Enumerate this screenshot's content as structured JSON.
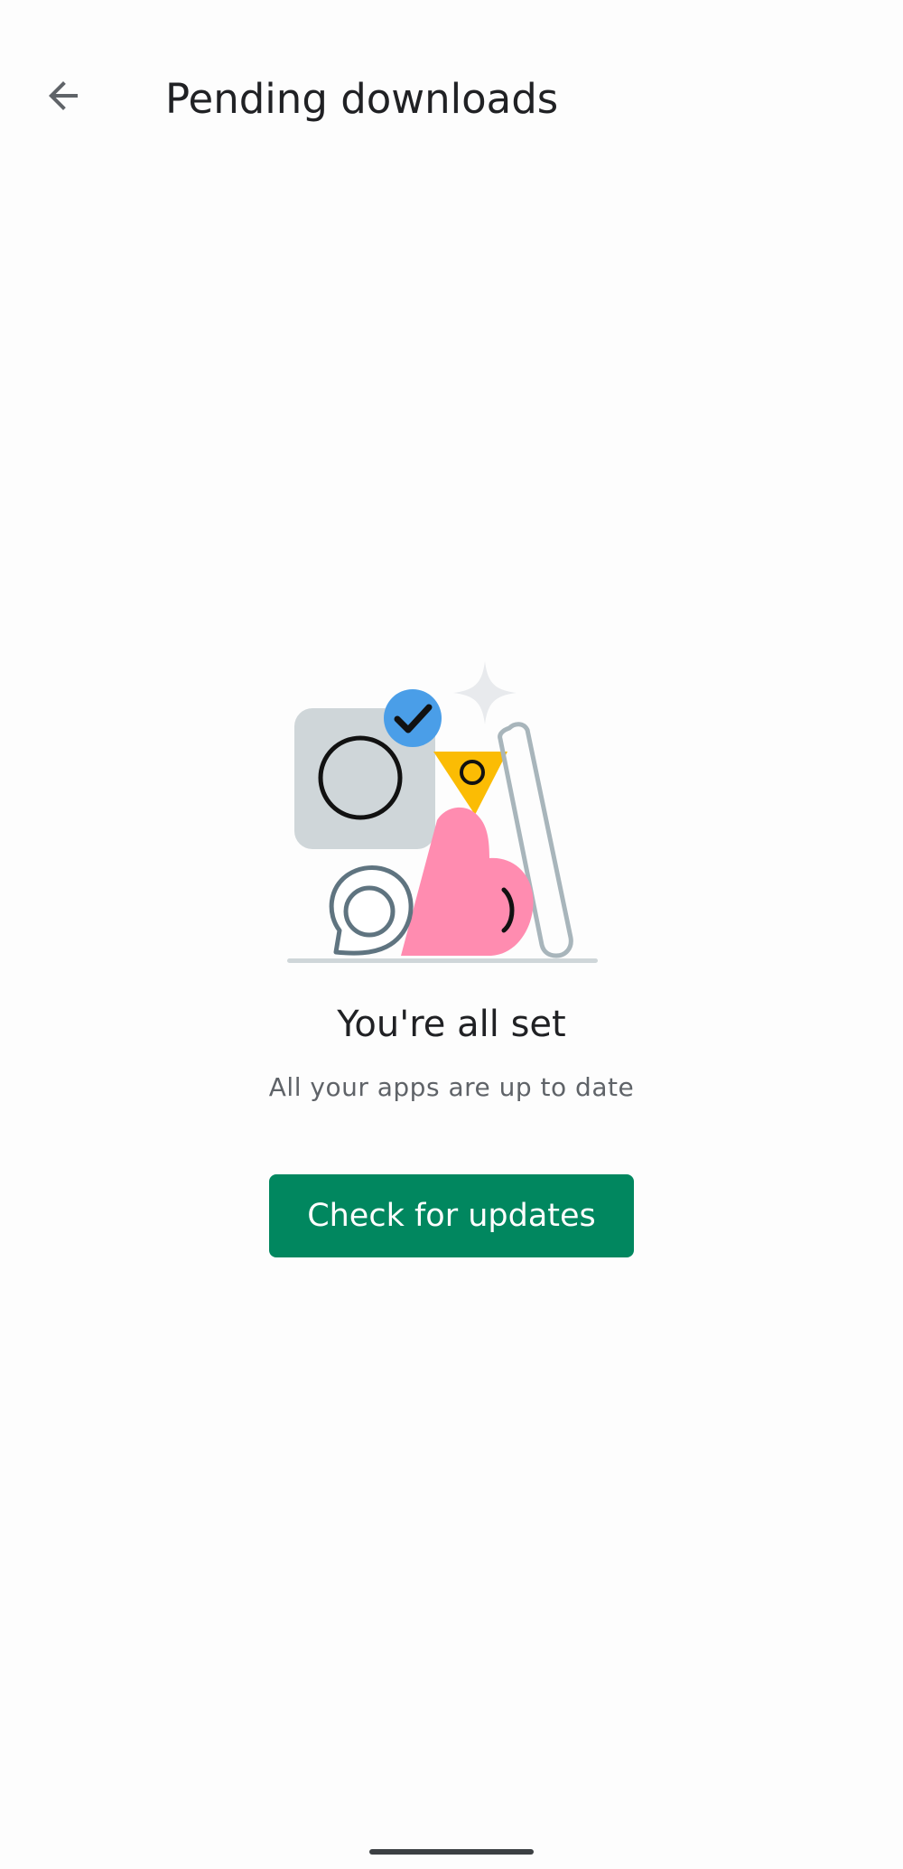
{
  "header": {
    "back_icon": "arrow-back-icon",
    "title": "Pending downloads"
  },
  "empty_state": {
    "illustration": "all-set-illustration",
    "title": "You're all set",
    "subtitle": "All your apps are up to date",
    "button_label": "Check for updates"
  },
  "colors": {
    "accent": "#01875f",
    "title_text": "#202124",
    "subtitle_text": "#5f6368",
    "background": "#fdfdfd"
  }
}
